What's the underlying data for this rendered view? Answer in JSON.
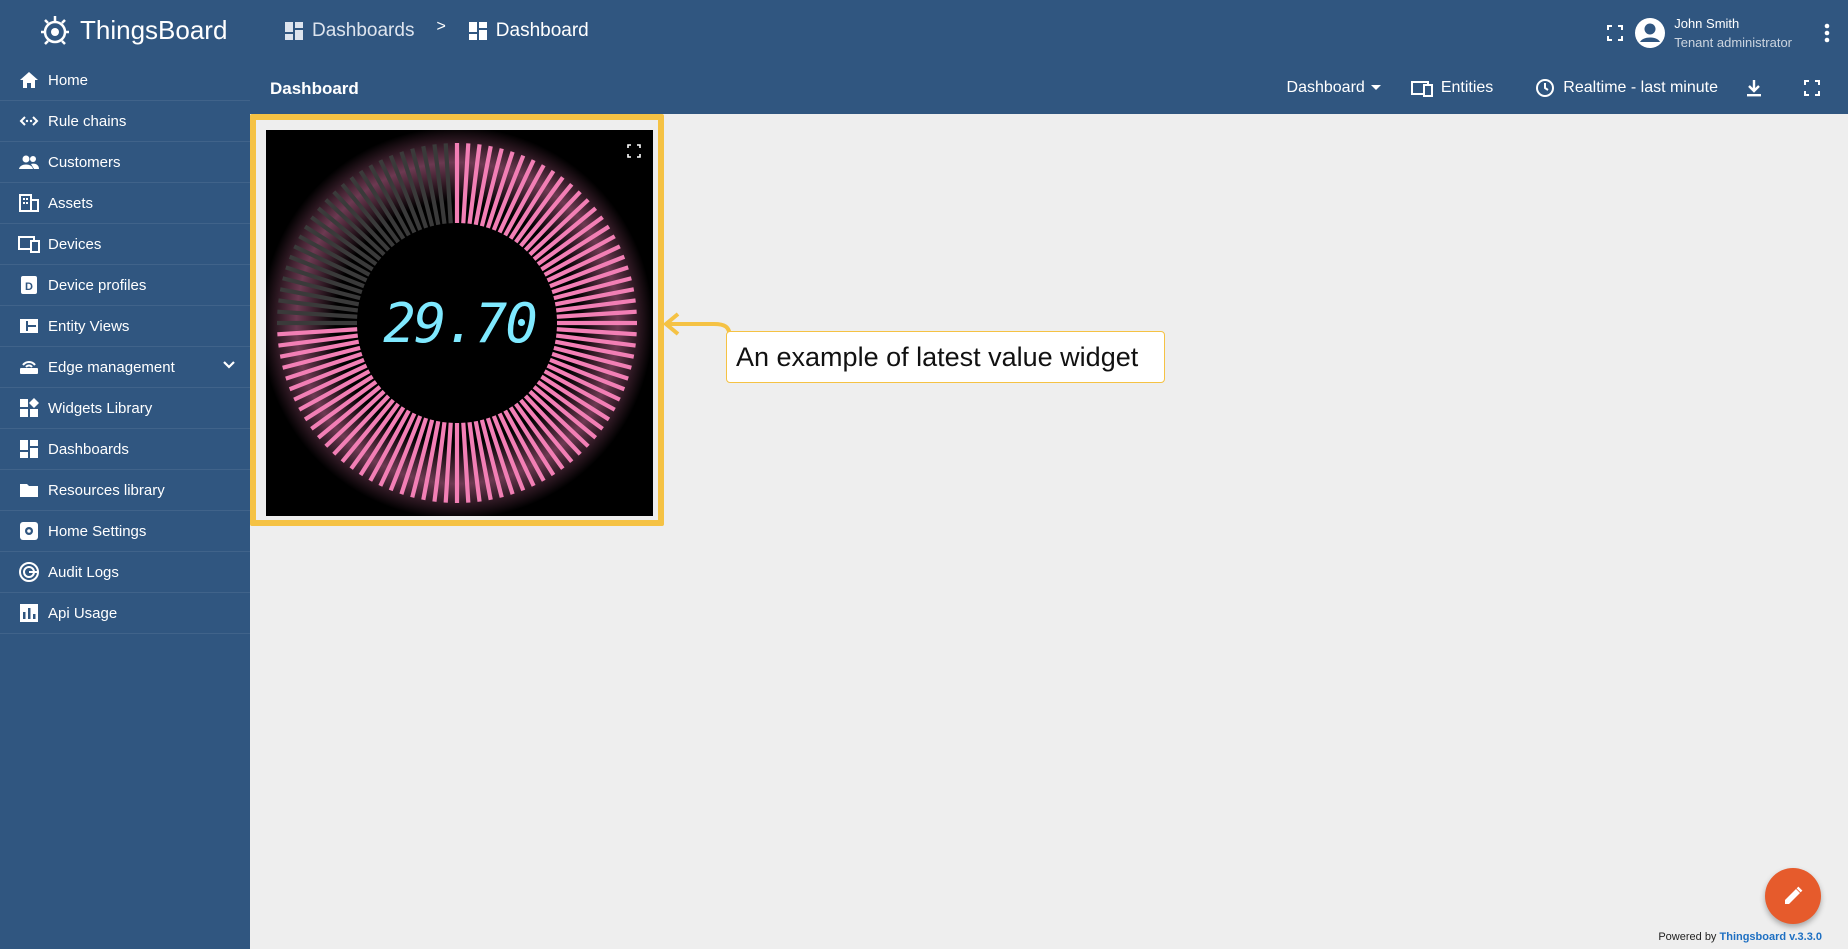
{
  "app": {
    "name": "ThingsBoard"
  },
  "sidebar": {
    "items": [
      {
        "label": "Home",
        "icon": "home-icon"
      },
      {
        "label": "Rule chains",
        "icon": "rule-chains-icon"
      },
      {
        "label": "Customers",
        "icon": "customers-icon"
      },
      {
        "label": "Assets",
        "icon": "assets-icon"
      },
      {
        "label": "Devices",
        "icon": "devices-icon"
      },
      {
        "label": "Device profiles",
        "icon": "device-profiles-icon"
      },
      {
        "label": "Entity Views",
        "icon": "entity-views-icon"
      },
      {
        "label": "Edge management",
        "icon": "edge-icon"
      },
      {
        "label": "Widgets Library",
        "icon": "widgets-icon"
      },
      {
        "label": "Dashboards",
        "icon": "dashboards-icon"
      },
      {
        "label": "Resources library",
        "icon": "folder-icon"
      },
      {
        "label": "Home Settings",
        "icon": "settings-icon"
      },
      {
        "label": "Audit Logs",
        "icon": "audit-icon"
      },
      {
        "label": "Api Usage",
        "icon": "chart-icon"
      }
    ]
  },
  "header": {
    "breadcrumbs": [
      "Dashboards",
      "Dashboard"
    ],
    "separator": ">",
    "user_name": "John Smith",
    "user_role": "Tenant administrator"
  },
  "dashboard": {
    "title": "Dashboard",
    "state_select": "Dashboard",
    "entities_label": "Entities",
    "timewindow_label": "Realtime - last minute"
  },
  "widget": {
    "value": "29.70",
    "gauge_level": 0.7,
    "bar_color": "#f27fb5",
    "inactive_color": "#3a3a3a",
    "digit_color": "#7fe9ff"
  },
  "callout": {
    "text": "An example of latest value widget"
  },
  "footer": {
    "prefix": "Powered by",
    "link": "Thingsboard v.3.3.0"
  },
  "colors": {
    "primary": "#305680",
    "accent": "#f5c244",
    "fab": "#e65b2c"
  }
}
